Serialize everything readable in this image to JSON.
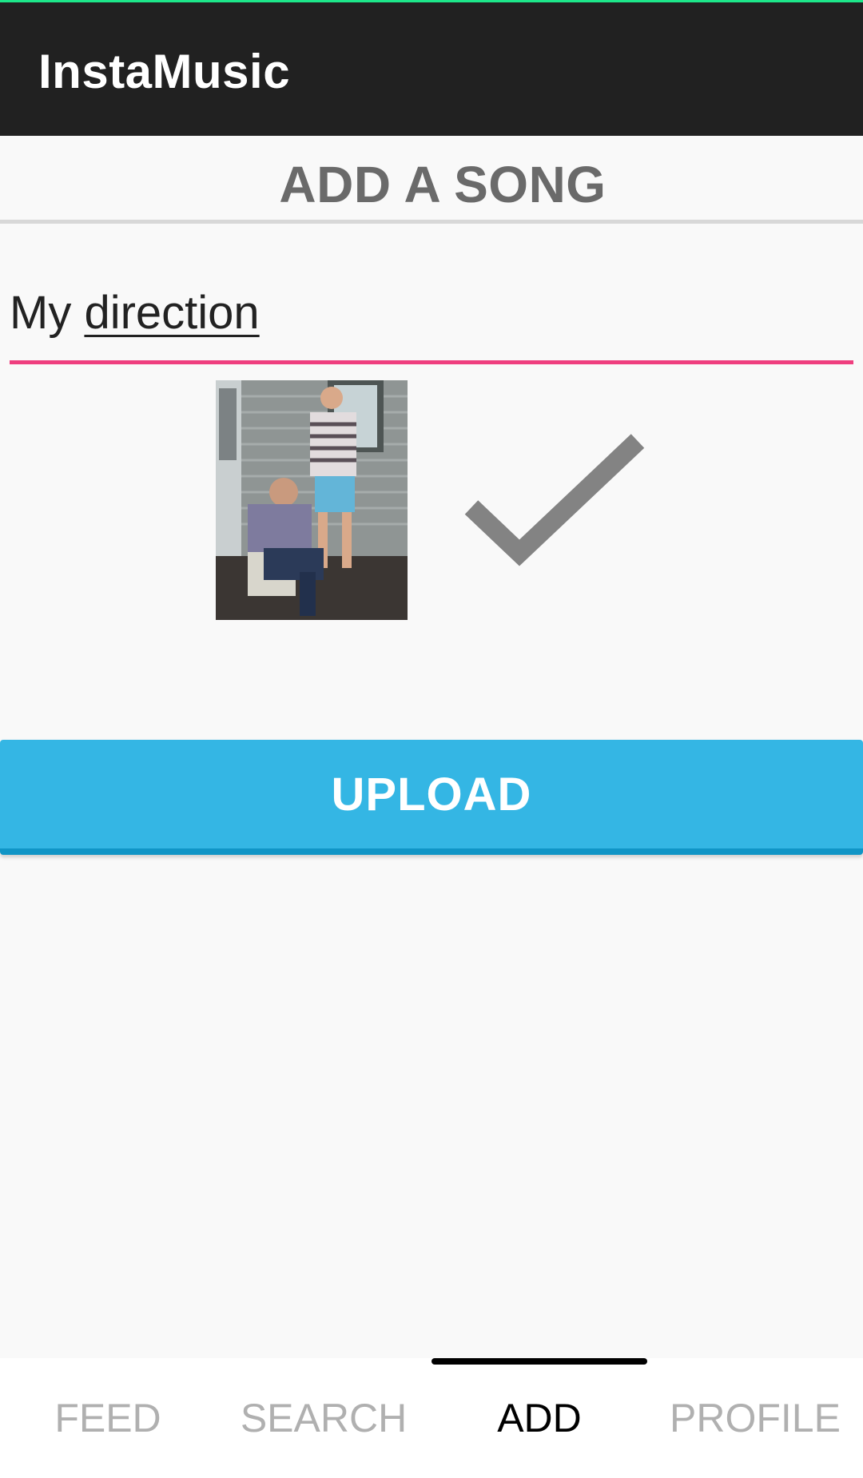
{
  "app": {
    "title": "InstaMusic"
  },
  "section": {
    "title": "ADD A SONG"
  },
  "song_field": {
    "word1": "My",
    "word2": "direction"
  },
  "cover": {
    "description_icon": "cover-photo"
  },
  "check": {
    "icon": "checkmark-icon"
  },
  "upload": {
    "label": "UPLOAD"
  },
  "tabs": [
    {
      "label": "FEED",
      "active": false
    },
    {
      "label": "SEARCH",
      "active": false
    },
    {
      "label": "ADD",
      "active": true
    },
    {
      "label": "PROFILE",
      "active": false
    }
  ],
  "colors": {
    "appbar": "#212121",
    "accent_pink": "#ef3f7f",
    "button_blue": "#34b6e4",
    "status_green": "#1de78a"
  }
}
